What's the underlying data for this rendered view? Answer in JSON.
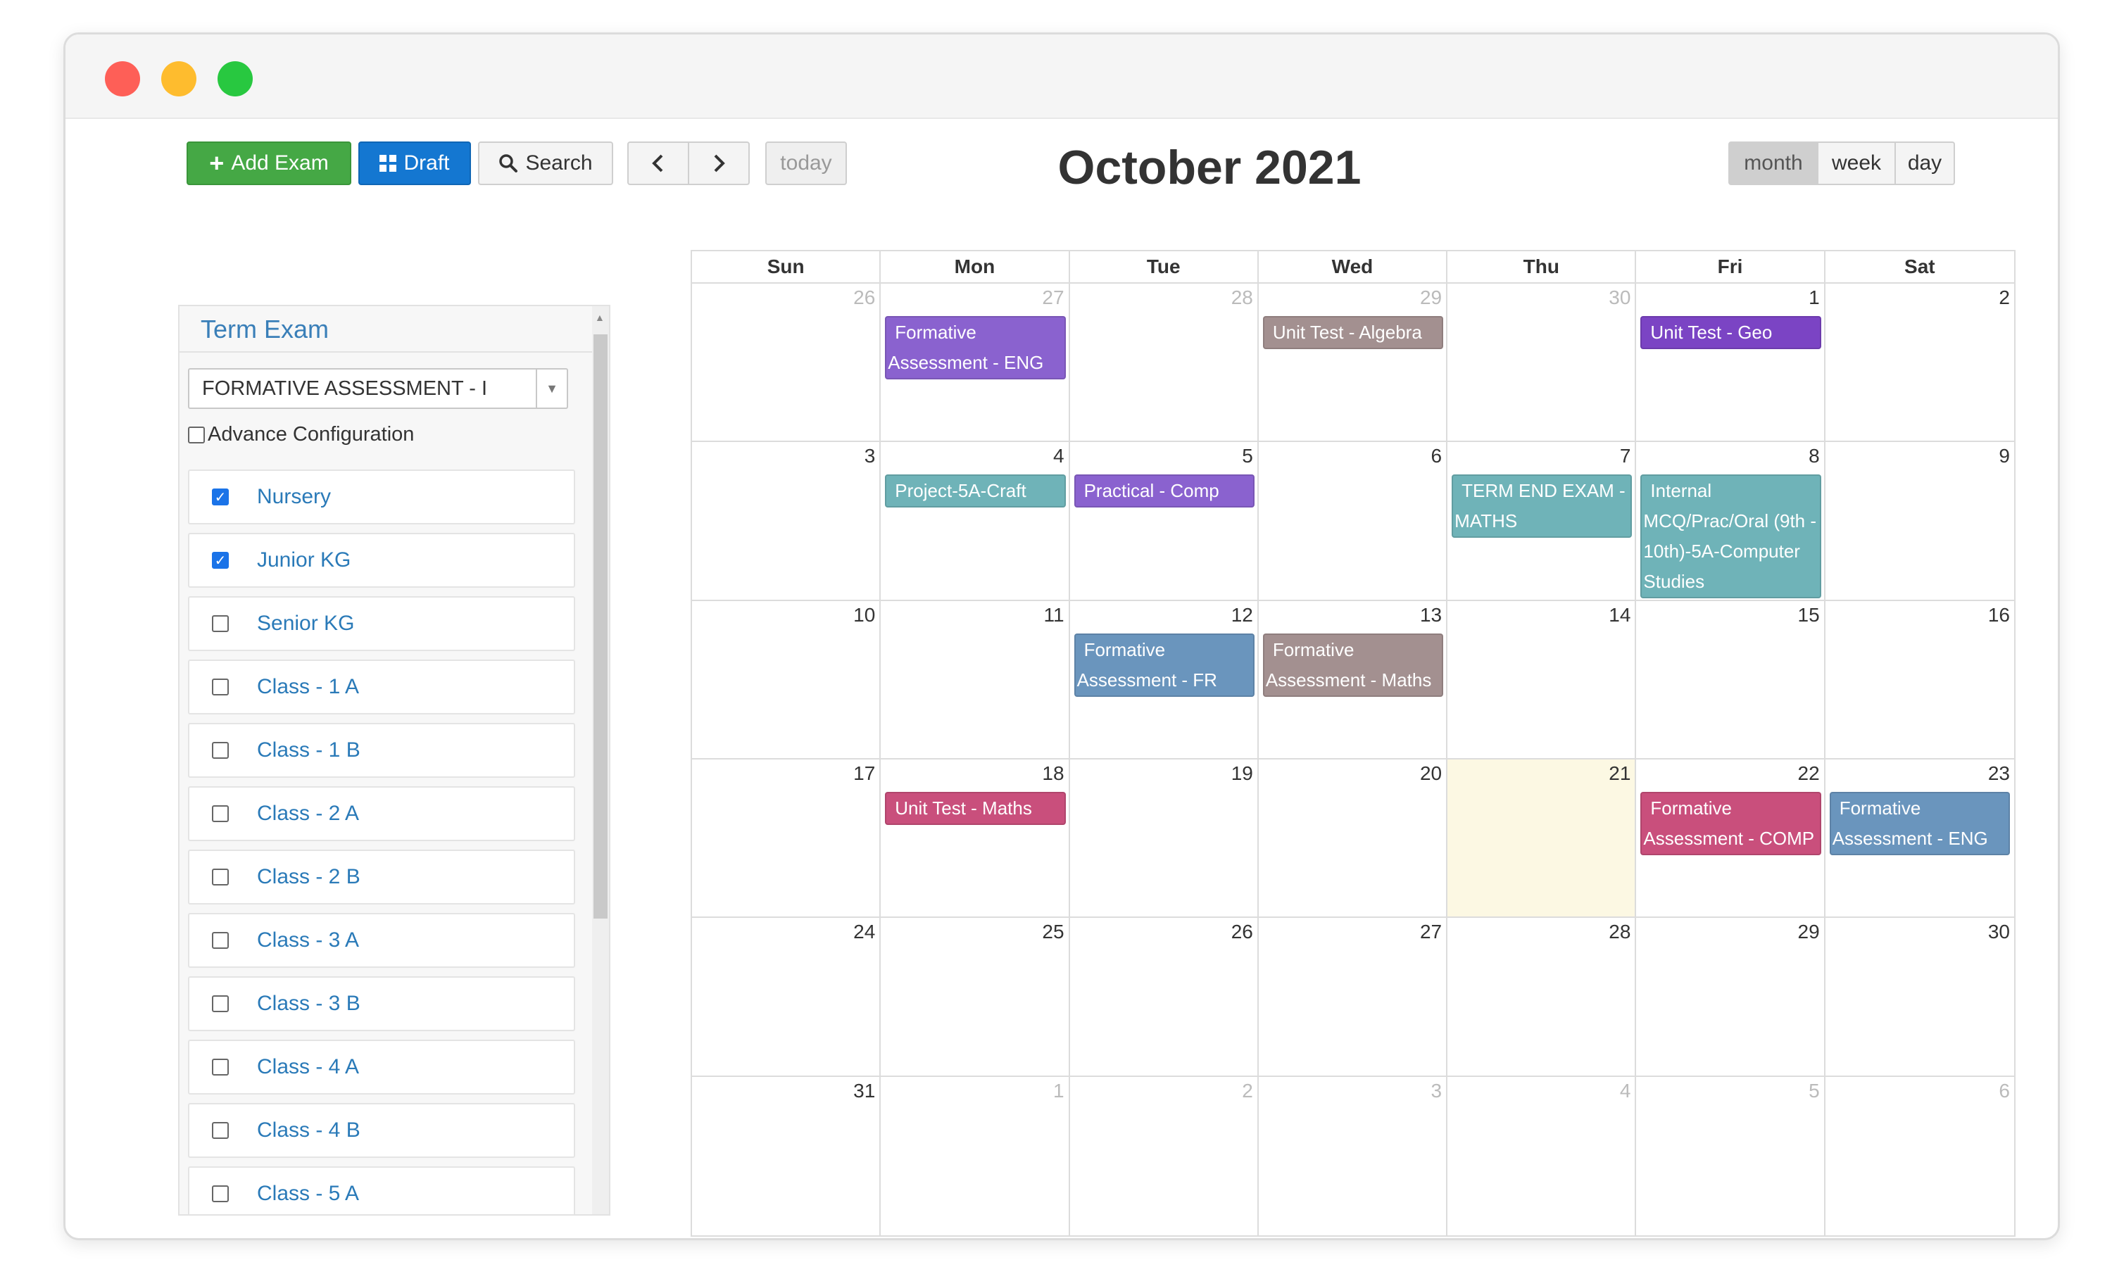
{
  "window": {
    "controls": [
      "close",
      "minimize",
      "maximize"
    ]
  },
  "toolbar": {
    "add_exam": "Add Exam",
    "draft": "Draft",
    "search": "Search",
    "today": "today",
    "title": "October 2021",
    "views": [
      "month",
      "week",
      "day"
    ],
    "active_view": "month"
  },
  "sidebar": {
    "title": "Term Exam",
    "select_value": "FORMATIVE ASSESSMENT - I",
    "advance_label": "Advance Configuration",
    "classes": [
      {
        "label": "Nursery",
        "checked": true
      },
      {
        "label": "Junior KG",
        "checked": true
      },
      {
        "label": "Senior KG",
        "checked": false
      },
      {
        "label": "Class - 1 A",
        "checked": false
      },
      {
        "label": "Class - 1 B",
        "checked": false
      },
      {
        "label": "Class - 2 A",
        "checked": false
      },
      {
        "label": "Class - 2 B",
        "checked": false
      },
      {
        "label": "Class - 3 A",
        "checked": false
      },
      {
        "label": "Class - 3 B",
        "checked": false
      },
      {
        "label": "Class - 4 A",
        "checked": false
      },
      {
        "label": "Class - 4 B",
        "checked": false
      },
      {
        "label": "Class - 5 A",
        "checked": false
      }
    ]
  },
  "calendar": {
    "weekdays": [
      "Sun",
      "Mon",
      "Tue",
      "Wed",
      "Thu",
      "Fri",
      "Sat"
    ],
    "weeks": [
      [
        {
          "d": "26",
          "other": true
        },
        {
          "d": "27",
          "other": true
        },
        {
          "d": "28",
          "other": true
        },
        {
          "d": "29",
          "other": true
        },
        {
          "d": "30",
          "other": true
        },
        {
          "d": "1"
        },
        {
          "d": "2"
        }
      ],
      [
        {
          "d": "3"
        },
        {
          "d": "4"
        },
        {
          "d": "5"
        },
        {
          "d": "6"
        },
        {
          "d": "7"
        },
        {
          "d": "8"
        },
        {
          "d": "9"
        }
      ],
      [
        {
          "d": "10"
        },
        {
          "d": "11"
        },
        {
          "d": "12"
        },
        {
          "d": "13"
        },
        {
          "d": "14"
        },
        {
          "d": "15"
        },
        {
          "d": "16"
        }
      ],
      [
        {
          "d": "17"
        },
        {
          "d": "18"
        },
        {
          "d": "19"
        },
        {
          "d": "20"
        },
        {
          "d": "21",
          "today": true
        },
        {
          "d": "22"
        },
        {
          "d": "23"
        }
      ],
      [
        {
          "d": "24"
        },
        {
          "d": "25"
        },
        {
          "d": "26"
        },
        {
          "d": "27"
        },
        {
          "d": "28"
        },
        {
          "d": "29"
        },
        {
          "d": "30"
        }
      ],
      [
        {
          "d": "31"
        },
        {
          "d": "1",
          "other": true
        },
        {
          "d": "2",
          "other": true
        },
        {
          "d": "3",
          "other": true
        },
        {
          "d": "4",
          "other": true
        },
        {
          "d": "5",
          "other": true
        },
        {
          "d": "6",
          "other": true
        }
      ]
    ],
    "events": [
      {
        "week": 0,
        "day": 1,
        "lines": [
          "Formative",
          "Assessment - ENG"
        ],
        "color": "#8a62cf"
      },
      {
        "week": 0,
        "day": 3,
        "lines": [
          "Unit Test - Algebra"
        ],
        "color": "#a39090"
      },
      {
        "week": 0,
        "day": 5,
        "lines": [
          "Unit Test - Geo"
        ],
        "color": "#7b44c4"
      },
      {
        "week": 1,
        "day": 1,
        "lines": [
          "Project-5A-Craft"
        ],
        "color": "#6fb3b8"
      },
      {
        "week": 1,
        "day": 2,
        "lines": [
          "Practical - Comp"
        ],
        "color": "#8a62cf"
      },
      {
        "week": 1,
        "day": 4,
        "lines": [
          "TERM END EXAM -",
          "MATHS"
        ],
        "color": "#6fb3b8"
      },
      {
        "week": 1,
        "day": 5,
        "lines": [
          "Internal",
          "MCQ/Prac/Oral (9th -",
          "10th)-5A-Computer",
          "Studies"
        ],
        "color": "#6fb3b8"
      },
      {
        "week": 2,
        "day": 2,
        "lines": [
          "Formative",
          "Assessment - FR"
        ],
        "color": "#6a95bd"
      },
      {
        "week": 2,
        "day": 3,
        "lines": [
          "Formative",
          "Assessment - Maths"
        ],
        "color": "#a39090"
      },
      {
        "week": 3,
        "day": 1,
        "lines": [
          "Unit Test - Maths"
        ],
        "color": "#c94f7c"
      },
      {
        "week": 3,
        "day": 5,
        "lines": [
          "Formative",
          "Assessment - COMP"
        ],
        "color": "#c94f7c"
      },
      {
        "week": 3,
        "day": 6,
        "lines": [
          "Formative",
          "Assessment - ENG"
        ],
        "color": "#6a95bd"
      }
    ]
  }
}
